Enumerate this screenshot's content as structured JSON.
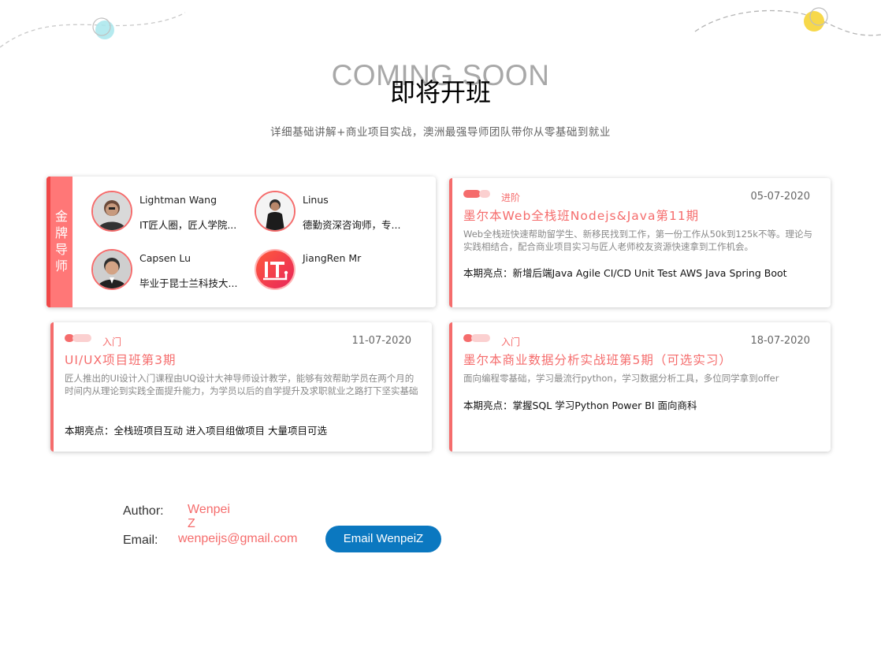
{
  "header": {
    "bg_title": "COMING SOON",
    "title": "即将开班",
    "subtitle": "详细基础讲解+商业项目实战，澳洲最强导师团队带你从零基础到就业"
  },
  "mentors": {
    "band_label": "金牌导师",
    "items": [
      {
        "name": "Lightman Wang",
        "desc": "IT匠人圈，匠人学院..."
      },
      {
        "name": "Linus",
        "desc": "德勤资深咨询师，专..."
      },
      {
        "name": "Capsen Lu",
        "desc": "毕业于昆士兰科技大..."
      },
      {
        "name": "JiangRen Mr",
        "desc": ""
      }
    ]
  },
  "courses": [
    {
      "level": "进阶",
      "date": "05-07-2020",
      "title": "墨尔本Web全栈班Nodejs&Java第11期",
      "desc": "Web全栈班快速帮助留学生、新移民找到工作，第一份工作从50k到125k不等。理论与实践相结合，配合商业项目实习与匠人老师校友资源快速拿到工作机会。",
      "highlights": "本期亮点：新增后端Java Agile CI/CD Unit Test AWS Java Spring Boot"
    },
    {
      "level": "入门",
      "date": "11-07-2020",
      "title": "UI/UX项目班第3期",
      "desc": "匠人推出的UI设计入门课程由UQ设计大神导师设计教学，能够有效帮助学员在两个月的时间内从理论到实践全面提升能力，为学员以后的自学提升及求职就业之路打下坚实基础",
      "highlights": "本期亮点：全栈班项目互动 进入项目组做项目 大量项目可选"
    },
    {
      "level": "入门",
      "date": "18-07-2020",
      "title": "墨尔本商业数据分析实战班第5期（可选实习）",
      "desc": "面向编程零基础，学习最流行python，学习数据分析工具，多位同学拿到offer",
      "highlights": "本期亮点：掌握SQL 学习Python Power BI 面向商科"
    }
  ],
  "footer": {
    "author_label": "Author:",
    "author_value": "Wenpei Z",
    "email_label": "Email:",
    "email_value": "wenpeijs@gmail.com",
    "email_button": "Email WenpeiZ"
  },
  "colors": {
    "accent": "#f56c6c",
    "band": "#ff7777",
    "button": "#0b78c0",
    "deco_cyan": "#9fe3ea",
    "deco_yellow": "#f7d84a"
  }
}
